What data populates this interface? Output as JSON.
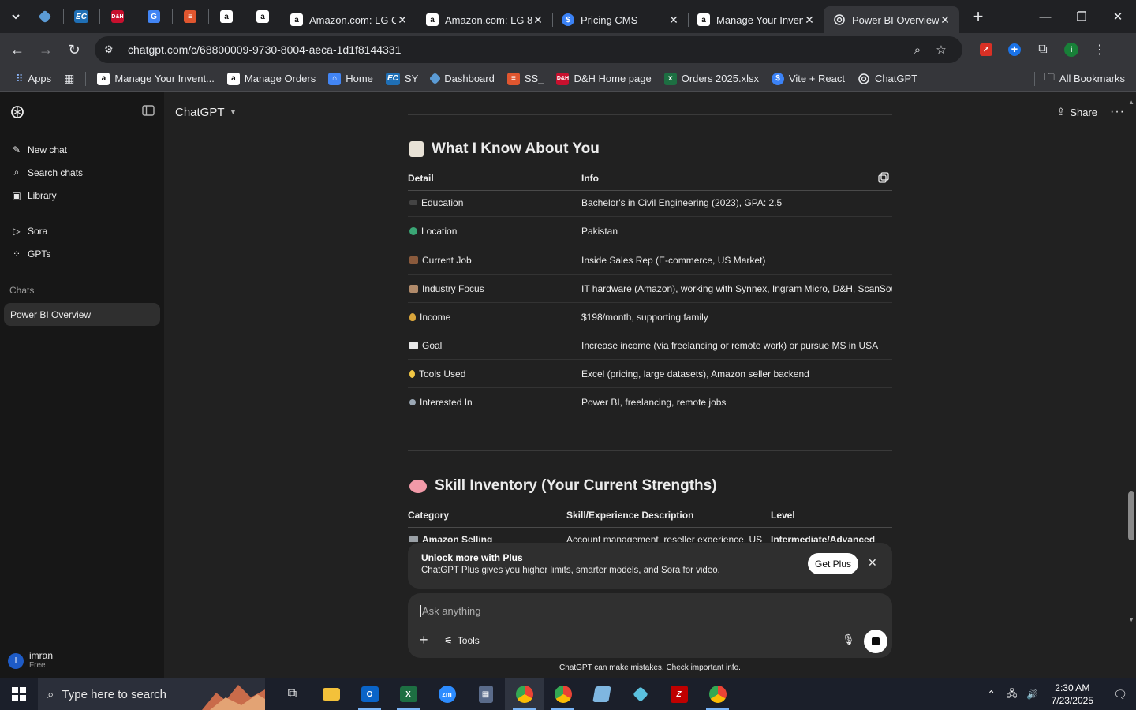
{
  "browser": {
    "tabs": [
      {
        "title": "Amazon.com: LG C",
        "favicon": "amazon"
      },
      {
        "title": "Amazon.com: LG 8",
        "favicon": "amazon"
      },
      {
        "title": "Pricing CMS",
        "favicon": "dollar"
      },
      {
        "title": "Manage Your Inven",
        "favicon": "amazon"
      },
      {
        "title": "Power BI Overview",
        "favicon": "chatgpt"
      }
    ],
    "url": "chatgpt.com/c/68800009-9730-8004-aeca-1d1f8144331",
    "bookmarks": [
      {
        "label": "Apps",
        "icon": "apps-grid-icon"
      },
      {
        "label": "Manage Your Invent...",
        "icon": "amazon-icon"
      },
      {
        "label": "Manage Orders",
        "icon": "amazon-icon"
      },
      {
        "label": "Home",
        "icon": "home-icon"
      },
      {
        "label": "SY",
        "icon": "ec-icon"
      },
      {
        "label": "Dashboard",
        "icon": "dashboard-icon"
      },
      {
        "label": "SS_",
        "icon": "box-icon"
      },
      {
        "label": "D&H Home page",
        "icon": "dh-icon"
      },
      {
        "label": "Orders 2025.xlsx",
        "icon": "excel-icon"
      },
      {
        "label": "Vite + React",
        "icon": "dollar-icon"
      },
      {
        "label": "ChatGPT",
        "icon": "chatgpt-icon"
      }
    ],
    "all_bookmarks": "All Bookmarks"
  },
  "sidebar": {
    "items": [
      {
        "label": "New chat",
        "icon": "edit-icon"
      },
      {
        "label": "Search chats",
        "icon": "search-icon"
      },
      {
        "label": "Library",
        "icon": "library-icon"
      }
    ],
    "items2": [
      {
        "label": "Sora",
        "icon": "play-icon"
      },
      {
        "label": "GPTs",
        "icon": "grid-icon"
      }
    ],
    "chats_label": "Chats",
    "active_chat": "Power BI Overview",
    "user": {
      "initial": "I",
      "name": "imran",
      "plan": "Free"
    }
  },
  "header": {
    "model": "ChatGPT",
    "share": "Share"
  },
  "section1": {
    "title": "What I Know About You",
    "col1": "Detail",
    "col2": "Info",
    "rows": [
      {
        "detail": "Education",
        "info": "Bachelor's in Civil Engineering (2023), GPA: 2.5"
      },
      {
        "detail": "Location",
        "info": "Pakistan"
      },
      {
        "detail": "Current Job",
        "info": "Inside Sales Rep (E-commerce, US Market)"
      },
      {
        "detail": "Industry Focus",
        "info": "IT hardware (Amazon), working with Synnex, Ingram Micro, D&H, ScanSource"
      },
      {
        "detail": "Income",
        "info": "$198/month, supporting family"
      },
      {
        "detail": "Goal",
        "info": "Increase income (via freelancing or remote work) or pursue MS in USA"
      },
      {
        "detail": "Tools Used",
        "info": "Excel (pricing, large datasets), Amazon seller backend"
      },
      {
        "detail": "Interested In",
        "info": "Power BI, freelancing, remote jobs"
      }
    ]
  },
  "section2": {
    "title": "Skill Inventory (Your Current Strengths)",
    "col1": "Category",
    "col2": "Skill/Experience Description",
    "col3": "Level",
    "row1": {
      "category": "Amazon Selling",
      "desc": "Account management, reseller experience, US",
      "level": "Intermediate/Advanced"
    }
  },
  "upsell": {
    "title": "Unlock more with Plus",
    "text": "ChatGPT Plus gives you higher limits, smarter models, and Sora for video.",
    "button": "Get Plus"
  },
  "composer": {
    "placeholder": "Ask anything",
    "tools": "Tools"
  },
  "disclaimer": "ChatGPT can make mistakes. Check important info.",
  "taskbar": {
    "search_placeholder": "Type here to search",
    "time": "2:30 AM",
    "date": "7/23/2025"
  },
  "colors": {
    "accent": "#1e5bc6",
    "bg": "#212121",
    "sidebar": "#171717"
  }
}
